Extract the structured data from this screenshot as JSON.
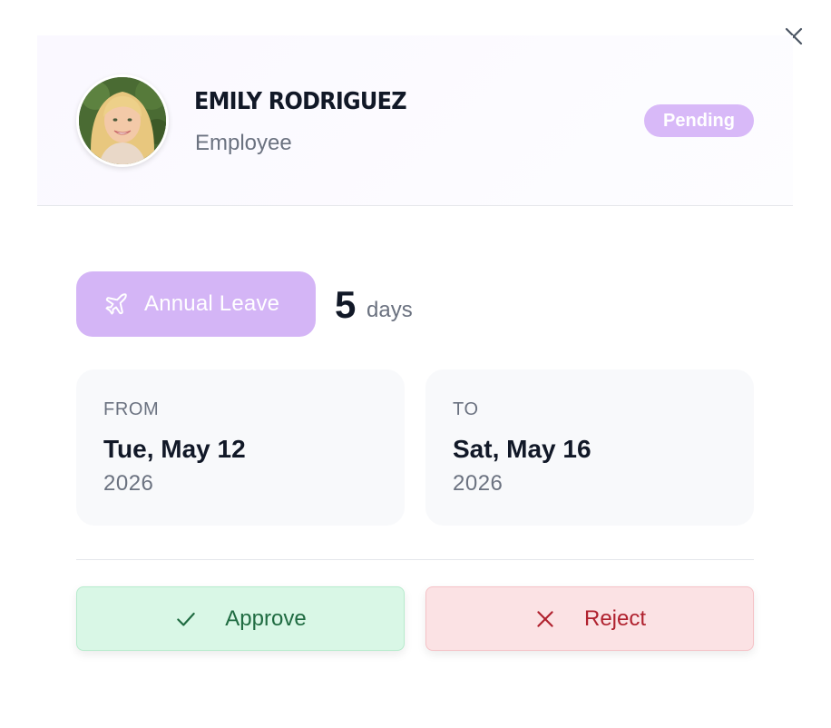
{
  "employee": {
    "name": "EMILY RODRIGUEZ",
    "role": "Employee",
    "status": "Pending"
  },
  "leave": {
    "type": "Annual Leave",
    "icon": "plane-icon",
    "days_count": "5",
    "days_unit": "days"
  },
  "from": {
    "caption": "FROM",
    "date": "Tue, May 12",
    "year": "2026"
  },
  "to": {
    "caption": "TO",
    "date": "Sat, May 16",
    "year": "2026"
  },
  "actions": {
    "approve_label": "Approve",
    "reject_label": "Reject"
  },
  "colors": {
    "accent_purple": "#d4b5f6",
    "approve_bg": "#d9f7e6",
    "approve_text": "#1f6b41",
    "reject_bg": "#fbe2e4",
    "reject_text": "#b0212e"
  }
}
